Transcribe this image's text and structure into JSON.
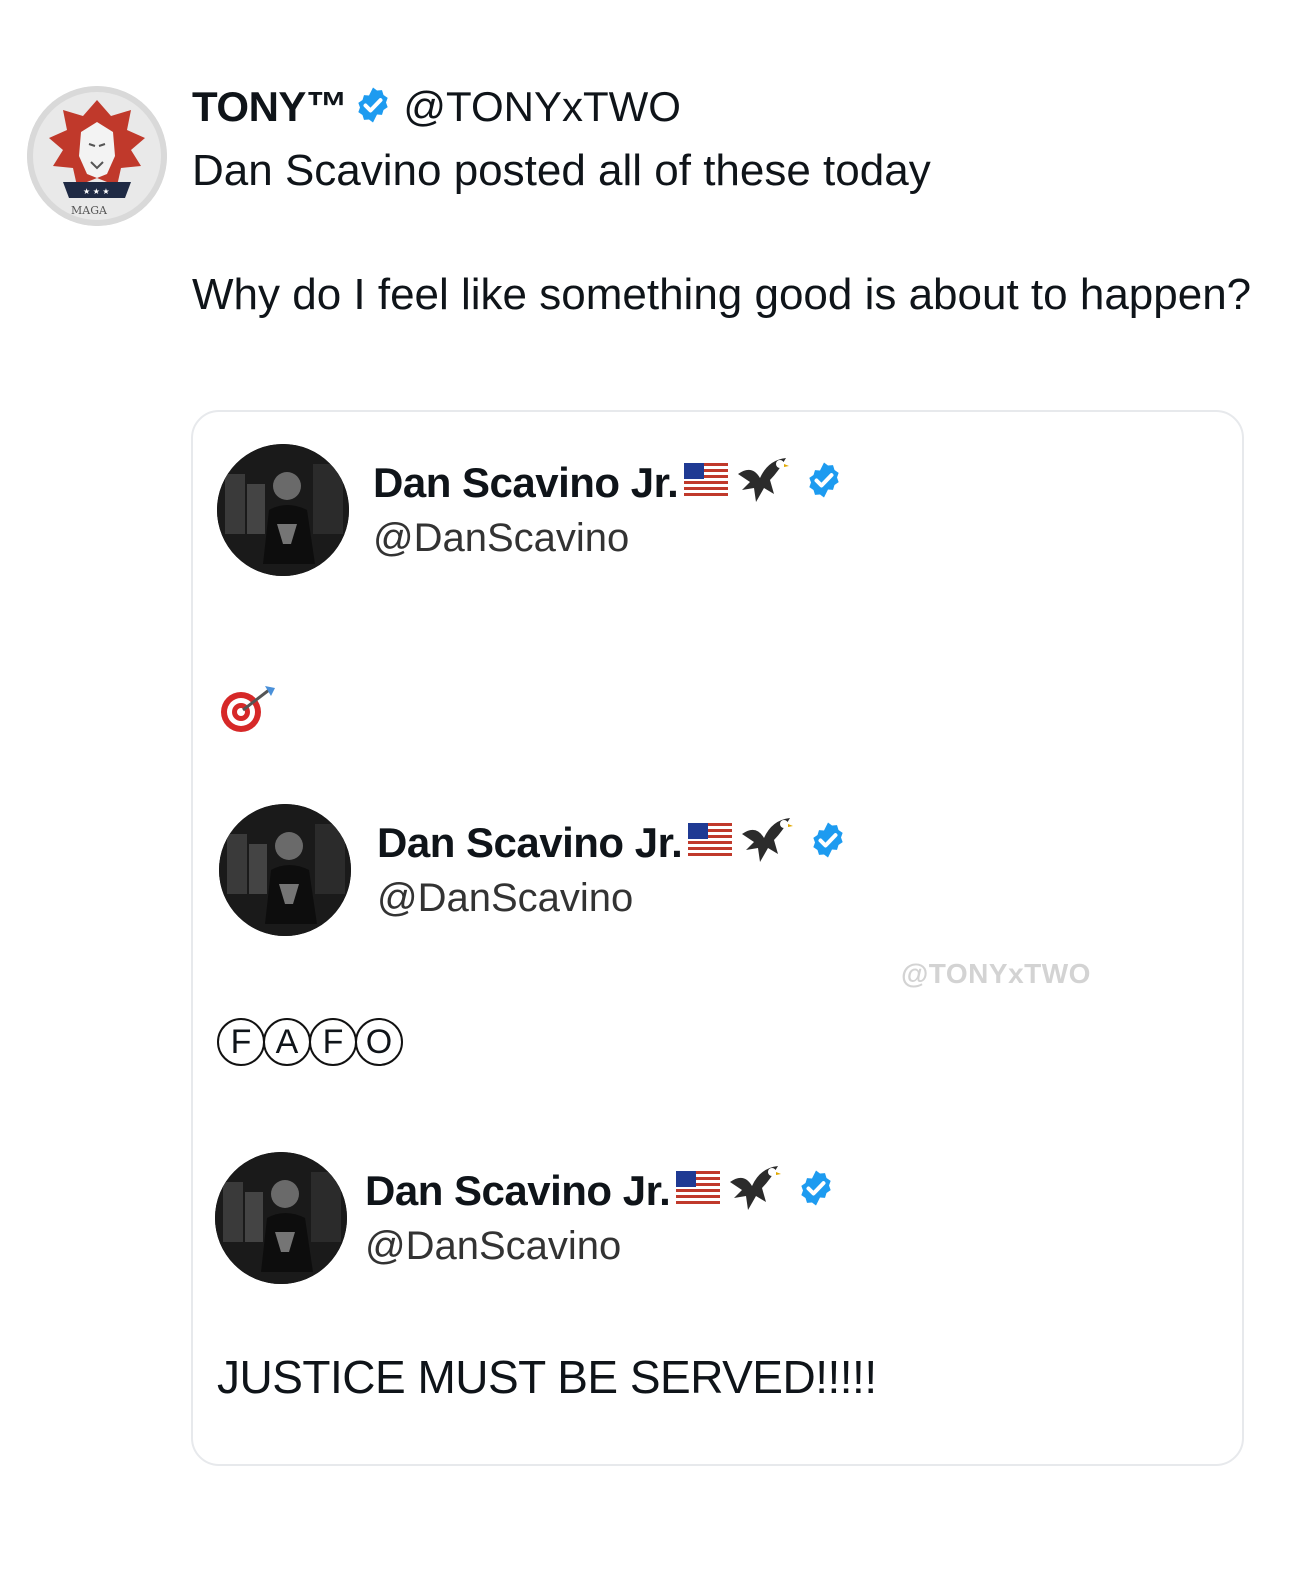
{
  "tweet": {
    "author": {
      "display_name": "TONY™",
      "handle": "@TONYxTWO",
      "verified": true,
      "avatar_label": "MAGA"
    },
    "text_line_1": "Dan Scavino posted all of these today",
    "text_line_2": "Why do I feel like something good is about to happen?"
  },
  "embedded_posts": [
    {
      "display_name": "Dan Scavino Jr.",
      "handle": "@DanScavino",
      "verified": true,
      "name_icons": [
        "us-flag-icon",
        "eagle-icon"
      ],
      "body_icon": "direct-hit-target-icon",
      "body": ""
    },
    {
      "display_name": "Dan Scavino Jr.",
      "handle": "@DanScavino",
      "verified": true,
      "name_icons": [
        "us-flag-icon",
        "eagle-icon"
      ],
      "body_letters": [
        "F",
        "A",
        "F",
        "O"
      ]
    },
    {
      "display_name": "Dan Scavino Jr.",
      "handle": "@DanScavino",
      "verified": true,
      "name_icons": [
        "us-flag-icon",
        "eagle-icon"
      ],
      "body": "JUSTICE MUST BE SERVED!!!!!"
    }
  ],
  "watermark": "@TONYxTWO",
  "colors": {
    "verified_blue": "#1d9bf0",
    "lion_red": "#c0392b",
    "border": "#e7e9ec"
  }
}
